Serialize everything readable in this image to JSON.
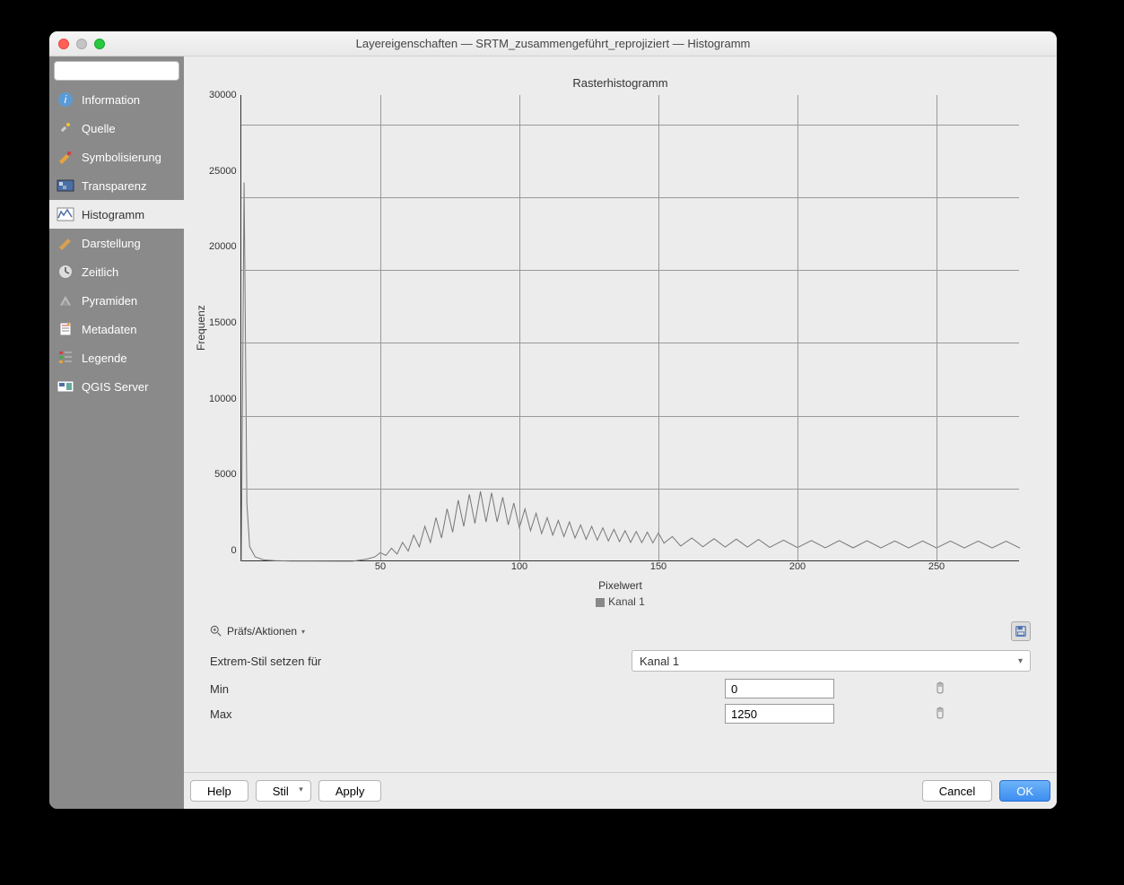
{
  "window": {
    "title": "Layereigenschaften — SRTM_zusammengeführt_reprojiziert — Histogramm"
  },
  "sidebar": {
    "items": [
      {
        "label": "Information",
        "icon": "info"
      },
      {
        "label": "Quelle",
        "icon": "source"
      },
      {
        "label": "Symbolisierung",
        "icon": "symbology"
      },
      {
        "label": "Transparenz",
        "icon": "transparency"
      },
      {
        "label": "Histogramm",
        "icon": "histogram"
      },
      {
        "label": "Darstellung",
        "icon": "rendering"
      },
      {
        "label": "Zeitlich",
        "icon": "temporal"
      },
      {
        "label": "Pyramiden",
        "icon": "pyramids"
      },
      {
        "label": "Metadaten",
        "icon": "metadata"
      },
      {
        "label": "Legende",
        "icon": "legend"
      },
      {
        "label": "QGIS Server",
        "icon": "server"
      }
    ],
    "active_index": 4
  },
  "chart_data": {
    "type": "line",
    "title": "Rasterhistogramm",
    "xlabel": "Pixelwert",
    "ylabel": "Frequenz",
    "xlim": [
      0,
      280
    ],
    "ylim": [
      0,
      32000
    ],
    "xticks": [
      50,
      100,
      150,
      200,
      250
    ],
    "yticks": [
      0,
      5000,
      10000,
      15000,
      20000,
      25000,
      30000
    ],
    "series": [
      {
        "name": "Kanal 1",
        "color": "#777777"
      }
    ],
    "legend_label": "Kanal 1",
    "x": [
      0,
      1,
      2,
      3,
      5,
      8,
      12,
      18,
      25,
      35,
      40,
      45,
      48,
      50,
      52,
      54,
      56,
      58,
      60,
      62,
      64,
      66,
      68,
      70,
      72,
      74,
      76,
      78,
      80,
      82,
      84,
      86,
      88,
      90,
      92,
      94,
      96,
      98,
      100,
      102,
      104,
      106,
      108,
      110,
      112,
      114,
      116,
      118,
      120,
      122,
      124,
      126,
      128,
      130,
      132,
      134,
      136,
      138,
      140,
      142,
      144,
      146,
      148,
      150,
      152,
      155,
      158,
      162,
      166,
      170,
      174,
      178,
      182,
      186,
      190,
      195,
      200,
      205,
      210,
      215,
      220,
      225,
      230,
      235,
      240,
      245,
      250,
      255,
      260,
      265,
      270,
      275,
      280
    ],
    "y": [
      0,
      26000,
      4000,
      1000,
      300,
      100,
      50,
      20,
      10,
      5,
      5,
      150,
      300,
      600,
      400,
      900,
      500,
      1300,
      700,
      1800,
      1000,
      2400,
      1300,
      3000,
      1600,
      3600,
      2000,
      4200,
      2400,
      4600,
      2600,
      4800,
      2700,
      4700,
      2700,
      4400,
      2500,
      4000,
      2300,
      3600,
      2100,
      3300,
      1900,
      3000,
      1800,
      2800,
      1700,
      2700,
      1600,
      2500,
      1500,
      2400,
      1450,
      2300,
      1400,
      2200,
      1350,
      2100,
      1300,
      2050,
      1280,
      2000,
      1260,
      1950,
      1250,
      1700,
      1050,
      1600,
      1000,
      1550,
      980,
      1520,
      970,
      1500,
      960,
      1450,
      940,
      1430,
      930,
      1420,
      925,
      1410,
      920,
      1400,
      918,
      1395,
      916,
      1390,
      915,
      1388,
      914,
      1386,
      913
    ]
  },
  "controls": {
    "prefs_label": "Präfs/Aktionen",
    "extrem_label": "Extrem-Stil setzen für",
    "channel_value": "Kanal 1",
    "min_label": "Min",
    "min_value": "0",
    "max_label": "Max",
    "max_value": "1250"
  },
  "footer": {
    "help": "Help",
    "style": "Stil",
    "apply": "Apply",
    "cancel": "Cancel",
    "ok": "OK"
  }
}
